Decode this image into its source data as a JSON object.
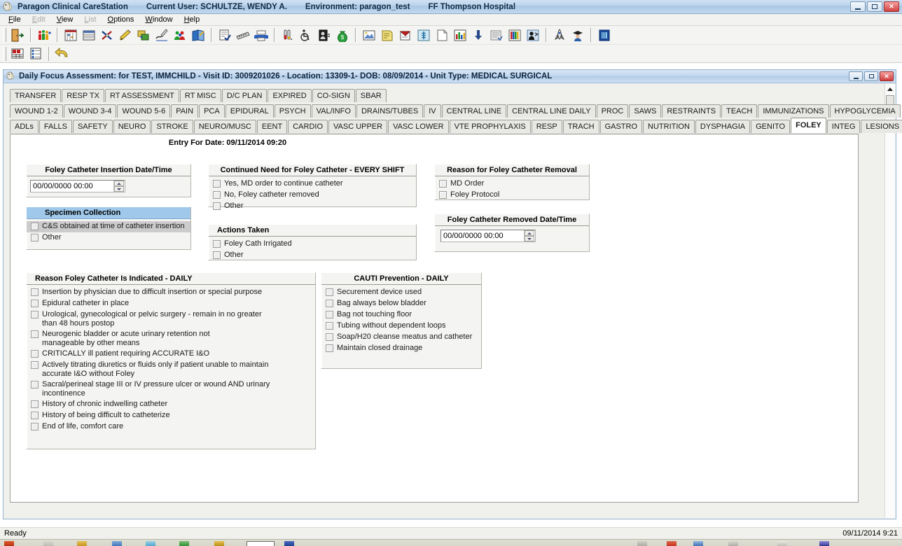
{
  "window": {
    "icon": "app-icon",
    "title_segments": [
      "Paragon Clinical CareStation",
      "Current User: SCHULTZE, WENDY A.",
      "Environment: paragon_test",
      "FF Thompson Hospital"
    ],
    "controls": [
      "minimize-button",
      "restore-button",
      "close-button"
    ]
  },
  "menu": [
    {
      "label": "File",
      "enabled": true
    },
    {
      "label": "Edit",
      "enabled": false
    },
    {
      "label": "View",
      "enabled": true
    },
    {
      "label": "List",
      "enabled": false
    },
    {
      "label": "Options",
      "enabled": true
    },
    {
      "label": "Window",
      "enabled": true
    },
    {
      "label": "Help",
      "enabled": true
    }
  ],
  "toolbar_row1": [
    "exit-door-icon",
    "sep",
    "people-group-icon",
    "sep",
    "patient-list-icon",
    "grid-list-icon",
    "orders-cross-icon",
    "pencil-edit-icon",
    "refresh-arrows-icon",
    "signature-icon",
    "care-team-icon",
    "chart-review-icon",
    "sep",
    "document-check-icon",
    "film-strip-icon",
    "printer-icon",
    "sep",
    "lab-tubes-icon",
    "wheelchair-icon",
    "id-badge-icon",
    "money-bag-icon",
    "sep",
    "imaging-icon",
    "notes-pad-icon",
    "red-folder-icon",
    "caduceus-icon",
    "blank-page-icon",
    "bar-chart-icon",
    "download-icon",
    "form-entry-icon",
    "books-icon",
    "person-speak-icon",
    "sep",
    "rocket-icon",
    "graduate-icon",
    "sep",
    "blue-box-icon"
  ],
  "toolbar_row2": [
    "numbers-grid-icon",
    "checklist-icon",
    "sep",
    "undo-arrow-icon"
  ],
  "child_window": {
    "icon": "app-icon",
    "title": "Daily Focus Assessment:  for TEST, IMMCHILD - Visit ID: 3009201026 - Location: 13309-1- DOB: 08/09/2014 - Unit Type: MEDICAL SURGICAL",
    "controls": [
      "minimize-button",
      "restore-button",
      "close-button"
    ]
  },
  "tabs": {
    "row1": [
      {
        "label": "TRANSFER",
        "selected": false
      },
      {
        "label": "RESP TX",
        "selected": false
      },
      {
        "label": "RT ASSESSMENT",
        "selected": false
      },
      {
        "label": "RT MISC",
        "selected": false
      },
      {
        "label": "D/C PLAN",
        "selected": false
      },
      {
        "label": "EXPIRED",
        "selected": false
      },
      {
        "label": "CO-SIGN",
        "selected": false
      },
      {
        "label": "SBAR",
        "selected": false
      }
    ],
    "row2": [
      {
        "label": "WOUND 1-2",
        "selected": false
      },
      {
        "label": "WOUND 3-4",
        "selected": false
      },
      {
        "label": "WOUND 5-6",
        "selected": false
      },
      {
        "label": "PAIN",
        "selected": false
      },
      {
        "label": "PCA",
        "selected": false
      },
      {
        "label": "EPIDURAL",
        "selected": false
      },
      {
        "label": "PSYCH",
        "selected": false
      },
      {
        "label": "VAL/INFO",
        "selected": false
      },
      {
        "label": "DRAINS/TUBES",
        "selected": false
      },
      {
        "label": "IV",
        "selected": false
      },
      {
        "label": "CENTRAL LINE",
        "selected": false
      },
      {
        "label": "CENTRAL LINE DAILY",
        "selected": false
      },
      {
        "label": "PROC",
        "selected": false
      },
      {
        "label": "SAWS",
        "selected": false
      },
      {
        "label": "RESTRAINTS",
        "selected": false
      },
      {
        "label": "TEACH",
        "selected": false
      },
      {
        "label": "IMMUNIZATIONS",
        "selected": false
      },
      {
        "label": "HYPOGLYCEMIA",
        "selected": false
      }
    ],
    "row3": [
      {
        "label": "ADLs",
        "selected": false
      },
      {
        "label": "FALLS",
        "selected": false
      },
      {
        "label": "SAFETY",
        "selected": false
      },
      {
        "label": "NEURO",
        "selected": false
      },
      {
        "label": "STROKE",
        "selected": false
      },
      {
        "label": "NEURO/MUSC",
        "selected": false
      },
      {
        "label": "EENT",
        "selected": false
      },
      {
        "label": "CARDIO",
        "selected": false
      },
      {
        "label": "VASC UPPER",
        "selected": false
      },
      {
        "label": "VASC LOWER",
        "selected": false
      },
      {
        "label": "VTE PROPHYLAXIS",
        "selected": false
      },
      {
        "label": "RESP",
        "selected": false
      },
      {
        "label": "TRACH",
        "selected": false
      },
      {
        "label": "GASTRO",
        "selected": false
      },
      {
        "label": "NUTRITION",
        "selected": false
      },
      {
        "label": "DYSPHAGIA",
        "selected": false
      },
      {
        "label": "GENITO",
        "selected": false
      },
      {
        "label": "FOLEY",
        "selected": true
      },
      {
        "label": "INTEG",
        "selected": false
      },
      {
        "label": "LESIONS",
        "selected": false
      }
    ]
  },
  "form": {
    "entry_for_date": "Entry For Date: 09/11/2014 09:20",
    "insertion_datetime": {
      "title": "Foley Catheter Insertion Date/Time",
      "value": "00/00/0000 00:00"
    },
    "specimen_collection": {
      "title": "Specimen Collection",
      "active": true,
      "items": [
        {
          "label": "C&S obtained at time of catheter insertion",
          "checked": false,
          "selected": true
        },
        {
          "label": "Other",
          "checked": false,
          "selected": false
        }
      ]
    },
    "continued_need": {
      "title": "Continued Need for Foley Catheter - EVERY SHIFT",
      "items": [
        {
          "label": "Yes, MD order to continue catheter",
          "checked": false
        },
        {
          "label": "No, Foley catheter removed",
          "checked": false
        },
        {
          "label": "Other",
          "checked": false
        }
      ]
    },
    "actions_taken": {
      "title": "Actions Taken",
      "items": [
        {
          "label": "Foley Cath Irrigated",
          "checked": false
        },
        {
          "label": "Other",
          "checked": false
        }
      ]
    },
    "removal_reason": {
      "title": "Reason for Foley Catheter Removal",
      "items": [
        {
          "label": "MD Order",
          "checked": false
        },
        {
          "label": "Foley Protocol",
          "checked": false
        }
      ]
    },
    "removed_datetime": {
      "title": "Foley Catheter Removed Date/Time",
      "value": "00/00/0000 00:00"
    },
    "reason_indicated": {
      "title": "Reason Foley Catheter Is Indicated - DAILY",
      "items": [
        {
          "label": "Insertion by physician due to difficult insertion or special purpose",
          "checked": false
        },
        {
          "label": "Epidural catheter in place",
          "checked": false
        },
        {
          "label": "Urological, gynecological or pelvic surgery - remain in no greater\nthan 48 hours postop",
          "checked": false
        },
        {
          "label": "Neurogenic bladder or acute urinary retention not\nmanageable by other means",
          "checked": false
        },
        {
          "label": "CRITICALLY ill patient requiring ACCURATE I&O",
          "checked": false
        },
        {
          "label": "Actively titrating diuretics or fluids only if patient unable to maintain\naccurate I&O without Foley",
          "checked": false
        },
        {
          "label": "Sacral/perineal stage III or IV pressure ulcer or wound AND urinary incontinence",
          "checked": false
        },
        {
          "label": "History of chronic indwelling catheter",
          "checked": false
        },
        {
          "label": "History of being difficult to catheterize",
          "checked": false
        },
        {
          "label": "End of life, comfort care",
          "checked": false
        }
      ]
    },
    "cauti_prevention": {
      "title": "CAUTI Prevention - DAILY",
      "items": [
        {
          "label": "Securement device used",
          "checked": false
        },
        {
          "label": "Bag always below bladder",
          "checked": false
        },
        {
          "label": "Bag not touching floor",
          "checked": false
        },
        {
          "label": "Tubing without dependent loops",
          "checked": false
        },
        {
          "label": "Soap/H20 cleanse meatus and catheter",
          "checked": false
        },
        {
          "label": "Maintain closed drainage",
          "checked": false
        }
      ]
    }
  },
  "statusbar": {
    "message": "Ready",
    "datetime": "09/11/2014  9:21"
  },
  "colors": {
    "titlebar": "#bdd4ec",
    "active_group_header": "#9fc8ea",
    "selected_row": "#cccccc",
    "form_background": "#f4f4f2",
    "page_background": "#ffffff"
  }
}
